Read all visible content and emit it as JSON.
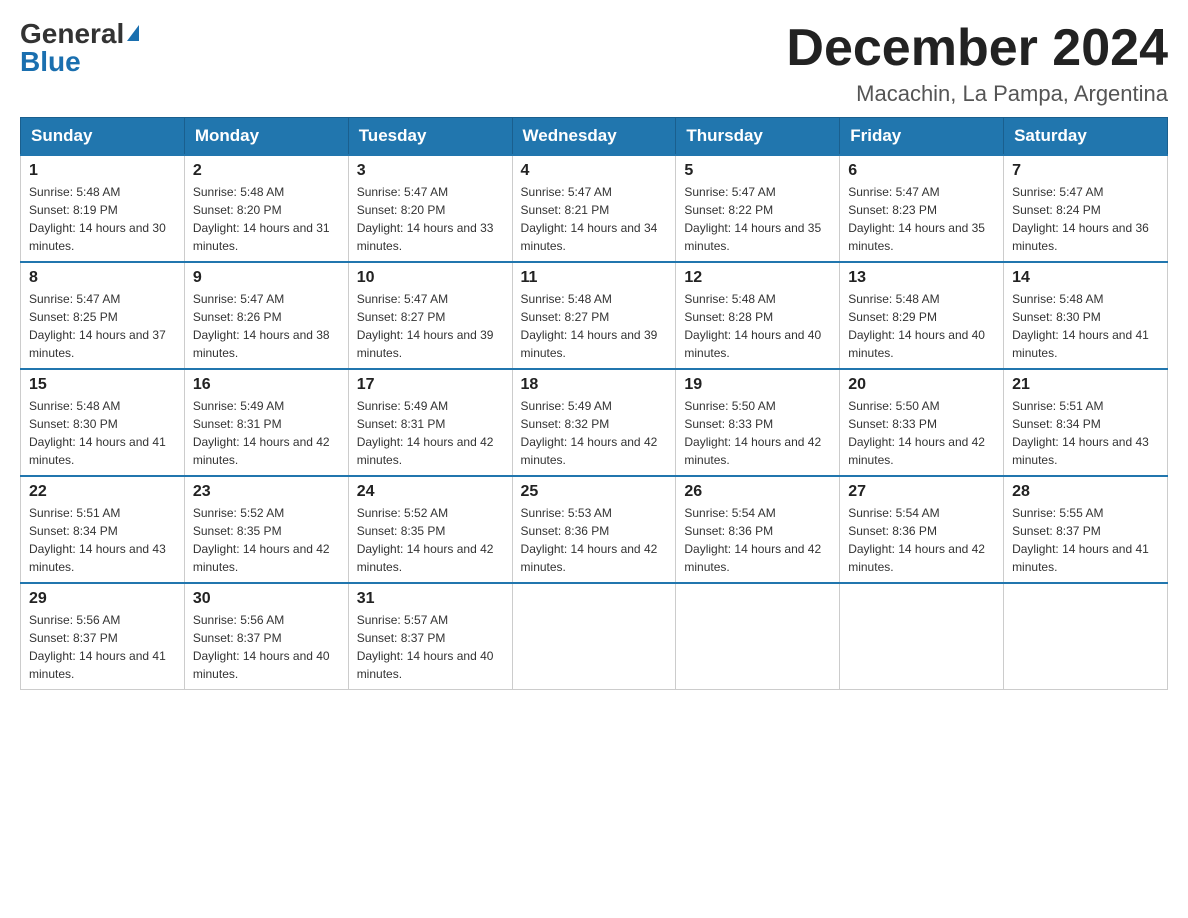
{
  "logo": {
    "text_general": "General",
    "text_blue": "Blue",
    "triangle": "▲"
  },
  "header": {
    "month_title": "December 2024",
    "location": "Macachin, La Pampa, Argentina"
  },
  "columns": [
    "Sunday",
    "Monday",
    "Tuesday",
    "Wednesday",
    "Thursday",
    "Friday",
    "Saturday"
  ],
  "weeks": [
    [
      {
        "day": "1",
        "sunrise": "Sunrise: 5:48 AM",
        "sunset": "Sunset: 8:19 PM",
        "daylight": "Daylight: 14 hours and 30 minutes."
      },
      {
        "day": "2",
        "sunrise": "Sunrise: 5:48 AM",
        "sunset": "Sunset: 8:20 PM",
        "daylight": "Daylight: 14 hours and 31 minutes."
      },
      {
        "day": "3",
        "sunrise": "Sunrise: 5:47 AM",
        "sunset": "Sunset: 8:20 PM",
        "daylight": "Daylight: 14 hours and 33 minutes."
      },
      {
        "day": "4",
        "sunrise": "Sunrise: 5:47 AM",
        "sunset": "Sunset: 8:21 PM",
        "daylight": "Daylight: 14 hours and 34 minutes."
      },
      {
        "day": "5",
        "sunrise": "Sunrise: 5:47 AM",
        "sunset": "Sunset: 8:22 PM",
        "daylight": "Daylight: 14 hours and 35 minutes."
      },
      {
        "day": "6",
        "sunrise": "Sunrise: 5:47 AM",
        "sunset": "Sunset: 8:23 PM",
        "daylight": "Daylight: 14 hours and 35 minutes."
      },
      {
        "day": "7",
        "sunrise": "Sunrise: 5:47 AM",
        "sunset": "Sunset: 8:24 PM",
        "daylight": "Daylight: 14 hours and 36 minutes."
      }
    ],
    [
      {
        "day": "8",
        "sunrise": "Sunrise: 5:47 AM",
        "sunset": "Sunset: 8:25 PM",
        "daylight": "Daylight: 14 hours and 37 minutes."
      },
      {
        "day": "9",
        "sunrise": "Sunrise: 5:47 AM",
        "sunset": "Sunset: 8:26 PM",
        "daylight": "Daylight: 14 hours and 38 minutes."
      },
      {
        "day": "10",
        "sunrise": "Sunrise: 5:47 AM",
        "sunset": "Sunset: 8:27 PM",
        "daylight": "Daylight: 14 hours and 39 minutes."
      },
      {
        "day": "11",
        "sunrise": "Sunrise: 5:48 AM",
        "sunset": "Sunset: 8:27 PM",
        "daylight": "Daylight: 14 hours and 39 minutes."
      },
      {
        "day": "12",
        "sunrise": "Sunrise: 5:48 AM",
        "sunset": "Sunset: 8:28 PM",
        "daylight": "Daylight: 14 hours and 40 minutes."
      },
      {
        "day": "13",
        "sunrise": "Sunrise: 5:48 AM",
        "sunset": "Sunset: 8:29 PM",
        "daylight": "Daylight: 14 hours and 40 minutes."
      },
      {
        "day": "14",
        "sunrise": "Sunrise: 5:48 AM",
        "sunset": "Sunset: 8:30 PM",
        "daylight": "Daylight: 14 hours and 41 minutes."
      }
    ],
    [
      {
        "day": "15",
        "sunrise": "Sunrise: 5:48 AM",
        "sunset": "Sunset: 8:30 PM",
        "daylight": "Daylight: 14 hours and 41 minutes."
      },
      {
        "day": "16",
        "sunrise": "Sunrise: 5:49 AM",
        "sunset": "Sunset: 8:31 PM",
        "daylight": "Daylight: 14 hours and 42 minutes."
      },
      {
        "day": "17",
        "sunrise": "Sunrise: 5:49 AM",
        "sunset": "Sunset: 8:31 PM",
        "daylight": "Daylight: 14 hours and 42 minutes."
      },
      {
        "day": "18",
        "sunrise": "Sunrise: 5:49 AM",
        "sunset": "Sunset: 8:32 PM",
        "daylight": "Daylight: 14 hours and 42 minutes."
      },
      {
        "day": "19",
        "sunrise": "Sunrise: 5:50 AM",
        "sunset": "Sunset: 8:33 PM",
        "daylight": "Daylight: 14 hours and 42 minutes."
      },
      {
        "day": "20",
        "sunrise": "Sunrise: 5:50 AM",
        "sunset": "Sunset: 8:33 PM",
        "daylight": "Daylight: 14 hours and 42 minutes."
      },
      {
        "day": "21",
        "sunrise": "Sunrise: 5:51 AM",
        "sunset": "Sunset: 8:34 PM",
        "daylight": "Daylight: 14 hours and 43 minutes."
      }
    ],
    [
      {
        "day": "22",
        "sunrise": "Sunrise: 5:51 AM",
        "sunset": "Sunset: 8:34 PM",
        "daylight": "Daylight: 14 hours and 43 minutes."
      },
      {
        "day": "23",
        "sunrise": "Sunrise: 5:52 AM",
        "sunset": "Sunset: 8:35 PM",
        "daylight": "Daylight: 14 hours and 42 minutes."
      },
      {
        "day": "24",
        "sunrise": "Sunrise: 5:52 AM",
        "sunset": "Sunset: 8:35 PM",
        "daylight": "Daylight: 14 hours and 42 minutes."
      },
      {
        "day": "25",
        "sunrise": "Sunrise: 5:53 AM",
        "sunset": "Sunset: 8:36 PM",
        "daylight": "Daylight: 14 hours and 42 minutes."
      },
      {
        "day": "26",
        "sunrise": "Sunrise: 5:54 AM",
        "sunset": "Sunset: 8:36 PM",
        "daylight": "Daylight: 14 hours and 42 minutes."
      },
      {
        "day": "27",
        "sunrise": "Sunrise: 5:54 AM",
        "sunset": "Sunset: 8:36 PM",
        "daylight": "Daylight: 14 hours and 42 minutes."
      },
      {
        "day": "28",
        "sunrise": "Sunrise: 5:55 AM",
        "sunset": "Sunset: 8:37 PM",
        "daylight": "Daylight: 14 hours and 41 minutes."
      }
    ],
    [
      {
        "day": "29",
        "sunrise": "Sunrise: 5:56 AM",
        "sunset": "Sunset: 8:37 PM",
        "daylight": "Daylight: 14 hours and 41 minutes."
      },
      {
        "day": "30",
        "sunrise": "Sunrise: 5:56 AM",
        "sunset": "Sunset: 8:37 PM",
        "daylight": "Daylight: 14 hours and 40 minutes."
      },
      {
        "day": "31",
        "sunrise": "Sunrise: 5:57 AM",
        "sunset": "Sunset: 8:37 PM",
        "daylight": "Daylight: 14 hours and 40 minutes."
      },
      null,
      null,
      null,
      null
    ]
  ]
}
